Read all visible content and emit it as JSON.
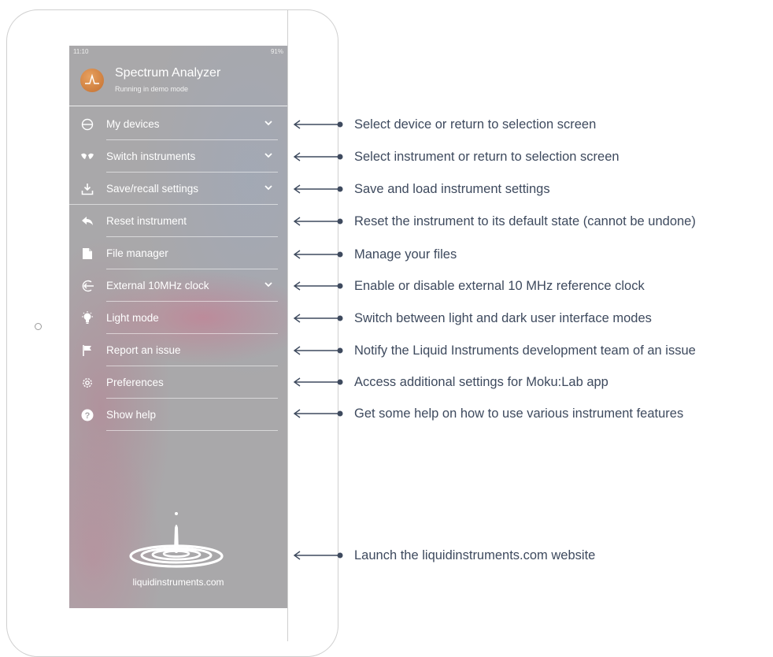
{
  "status_bar": {
    "time": "11:10",
    "battery": "91%"
  },
  "app": {
    "title": "Spectrum Analyzer",
    "subtitle": "Running in demo mode"
  },
  "menu": {
    "items": [
      {
        "label": "My devices",
        "icon": "device-icon",
        "expandable": true
      },
      {
        "label": "Switch instruments",
        "icon": "instruments-icon",
        "expandable": true
      },
      {
        "label": "Save/recall settings",
        "icon": "download-icon",
        "expandable": true
      },
      {
        "label": "Reset instrument",
        "icon": "reset-arrow-icon",
        "expandable": false
      },
      {
        "label": "File manager",
        "icon": "file-icon",
        "expandable": false
      },
      {
        "label": "External 10MHz clock",
        "icon": "external-clock-icon",
        "expandable": true
      },
      {
        "label": "Light mode",
        "icon": "lightbulb-icon",
        "expandable": false
      },
      {
        "label": "Report an issue",
        "icon": "flag-icon",
        "expandable": false
      },
      {
        "label": "Preferences",
        "icon": "gear-icon",
        "expandable": false
      },
      {
        "label": "Show help",
        "icon": "help-icon",
        "expandable": false
      }
    ]
  },
  "footer": {
    "website": "liquidinstruments.com",
    "logo_icon": "liquid-drop-logo-icon"
  },
  "annotations": [
    "Select device or return to selection screen",
    "Select instrument or return to selection screen",
    "Save and load instrument settings",
    "Reset the instrument to its default state (cannot be undone)",
    "Manage your files",
    "Enable or disable external 10 MHz reference clock",
    "Switch between light and dark user interface modes",
    "Notify the Liquid Instruments development team of an issue",
    "Access additional settings for Moku:Lab app",
    "Get some help on how to use various instrument features",
    "Launch the liquidinstruments.com website"
  ],
  "colors": {
    "annotation_text": "#3e4a5e",
    "panel_bg": "#a9a8aa",
    "avatar": "#d98a45"
  }
}
